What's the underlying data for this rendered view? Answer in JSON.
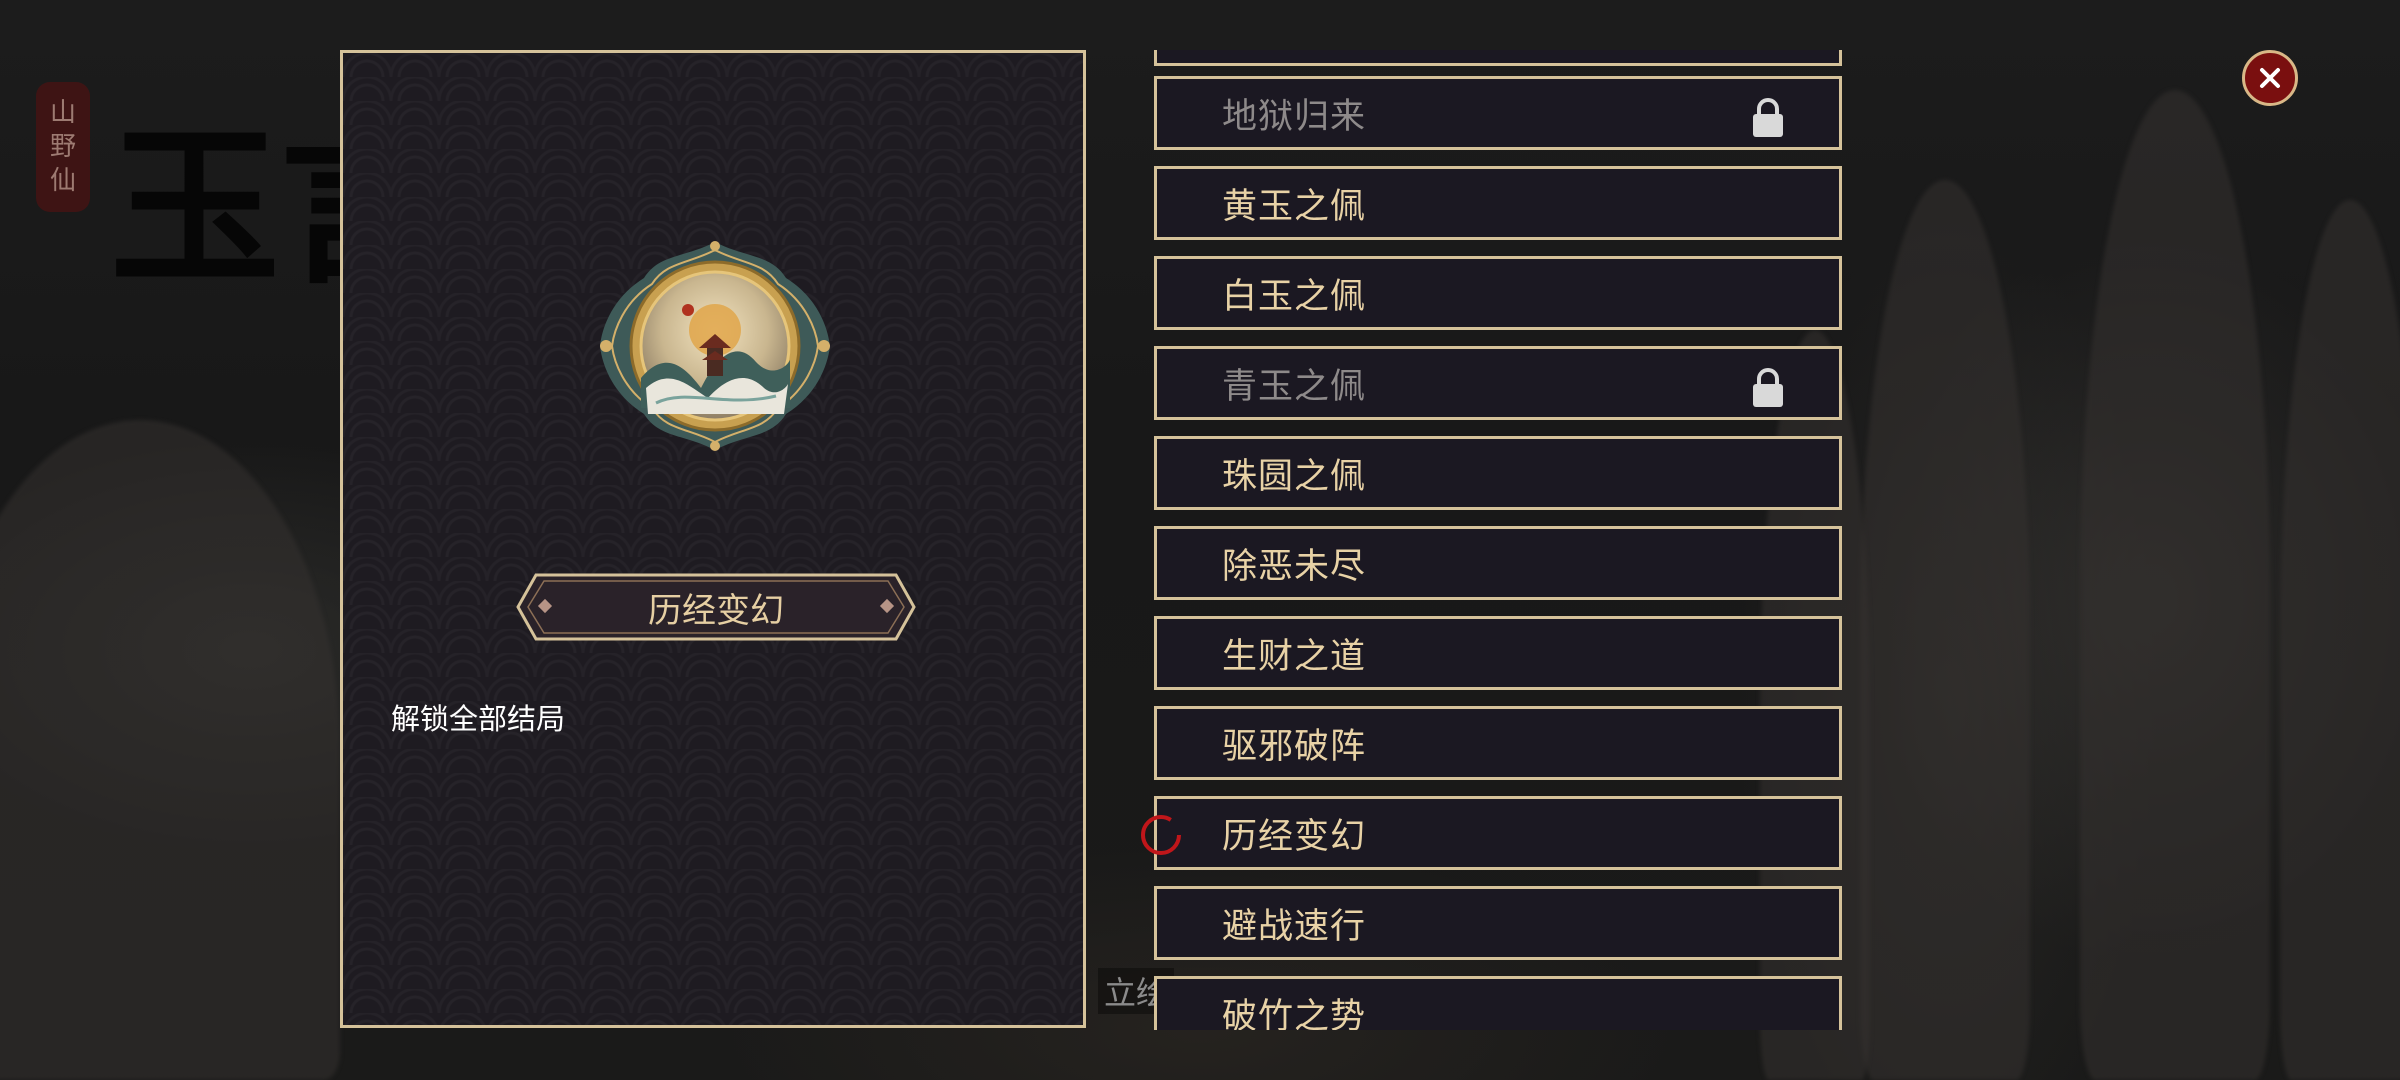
{
  "background": {
    "seal_text": [
      "山",
      "野",
      "仙"
    ],
    "title_fragment": "玉言",
    "caption": "立绘"
  },
  "detail": {
    "badge_icon": "landscape-medallion-icon",
    "title": "历经变幻",
    "description": "解锁全部结局"
  },
  "achievements": [
    {
      "label": "",
      "locked": false
    },
    {
      "label": "地狱归来",
      "locked": true
    },
    {
      "label": "黄玉之佩",
      "locked": false
    },
    {
      "label": "白玉之佩",
      "locked": false
    },
    {
      "label": "青玉之佩",
      "locked": true
    },
    {
      "label": "珠圆之佩",
      "locked": false
    },
    {
      "label": "除恶未尽",
      "locked": false
    },
    {
      "label": "生财之道",
      "locked": false
    },
    {
      "label": "驱邪破阵",
      "locked": false
    },
    {
      "label": "历经变幻",
      "locked": false,
      "selected": true
    },
    {
      "label": "避战速行",
      "locked": false
    },
    {
      "label": "破竹之势",
      "locked": false
    }
  ],
  "colors": {
    "gold_border": "#d5c29a",
    "label_gold": "#e8d2a6",
    "locked_text": "#8e8a8a",
    "close_red": "#7a0f0f"
  },
  "close_icon": "close-icon"
}
